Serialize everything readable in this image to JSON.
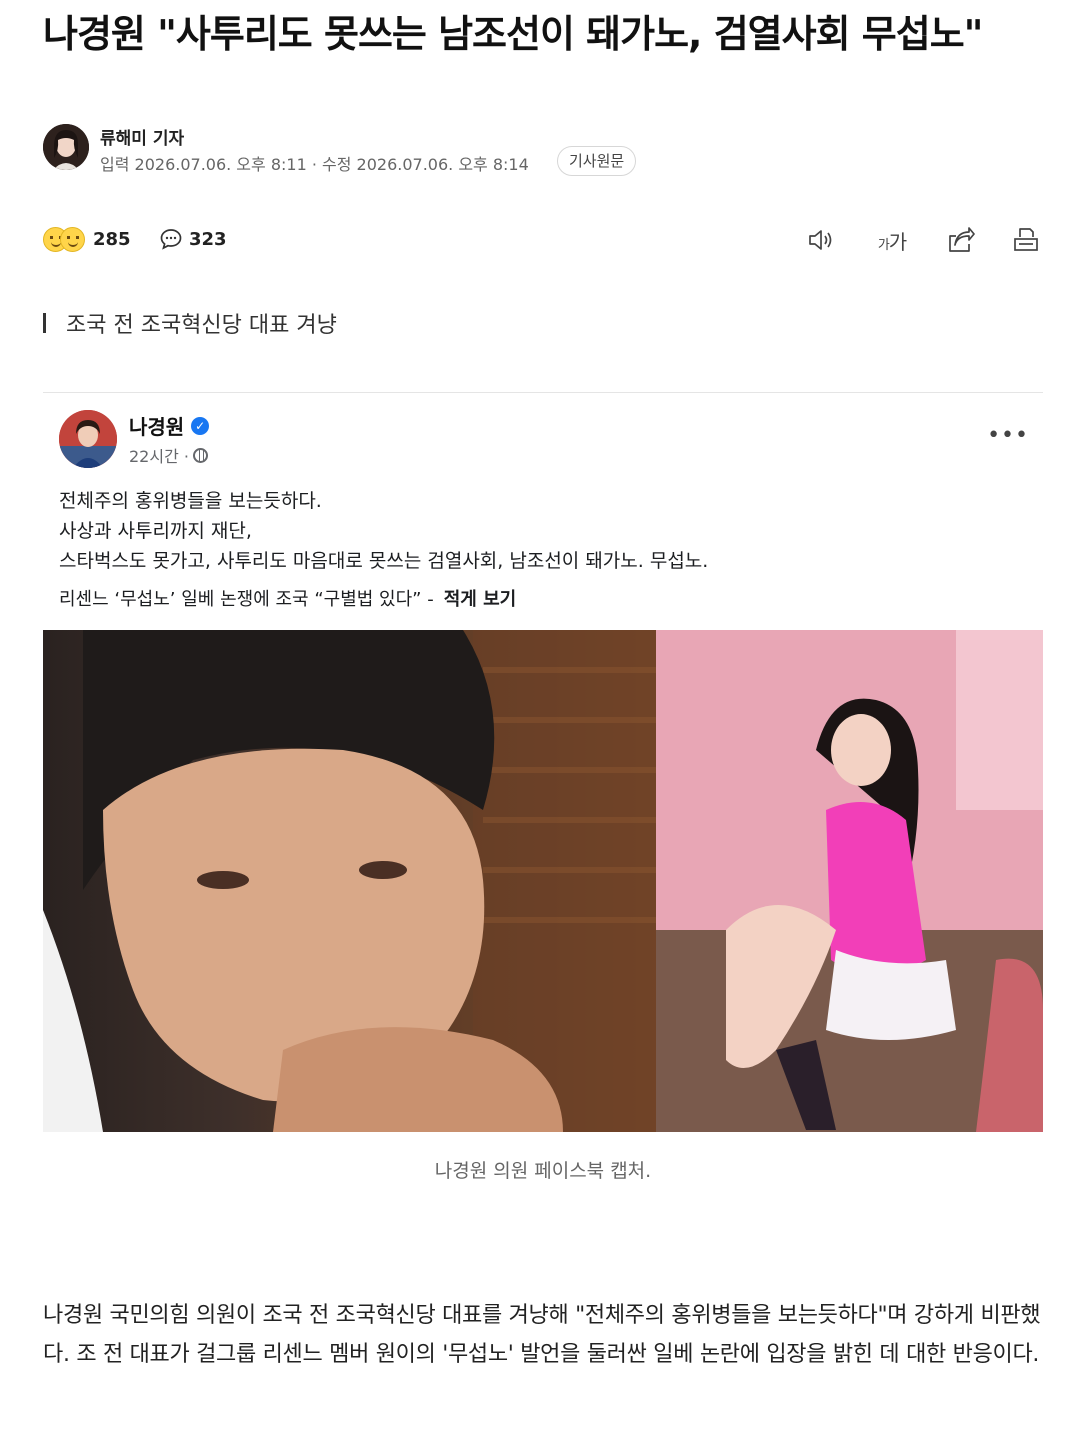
{
  "article": {
    "headline": "나경원 \"사투리도 못쓰는 남조선이 돼가노, 검열사회 무섭노\"",
    "reporter": "류해미 기자",
    "dates": "입력 2026.07.06. 오후 8:11 · 수정 2026.07.06. 오후 8:14",
    "original_button": "기사원문",
    "subtitle": "조국 전 조국혁신당 대표 겨냥",
    "caption": "나경원 의원 페이스북 캡처.",
    "body": "나경원 국민의힘 의원이 조국 전 조국혁신당 대표를 겨냥해 \"전체주의 홍위병들을 보는듯하다\"며 강하게 비판했다. 조 전 대표가 걸그룹 리센느 멤버 원이의 '무섭노' 발언을 둘러싼 일베 논란에 입장을 밝힌 데 대한 반응이다."
  },
  "toolbar": {
    "reaction_count": "285",
    "comment_count": "323",
    "font_size_label_small": "가",
    "font_size_label_large": "가",
    "icons": [
      "tts-speaker-icon",
      "font-size-icon",
      "share-icon",
      "print-icon"
    ]
  },
  "facebook_post": {
    "author": "나경원",
    "verified_mark": "✓",
    "time": "22시간 ·",
    "more": "•••",
    "lines": [
      "전체주의 홍위병들을 보는듯하다.",
      "사상과 사투리까지 재단,",
      "스타벅스도 못가고, 사투리도 마음대로 못쓰는 검열사회, 남조선이 돼가노. 무섭노."
    ],
    "link_text": "리센느 ‘무섭노’ 일베 논쟁에 조국 “구별법 있다” -",
    "link_action": "적게 보기"
  },
  "colors": {
    "verified_blue": "#1877f2",
    "text_primary": "#111111",
    "text_muted": "#666666"
  }
}
